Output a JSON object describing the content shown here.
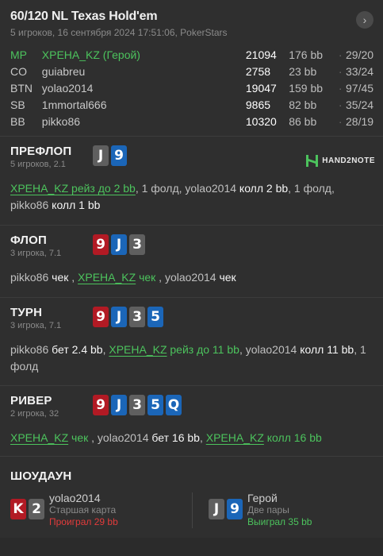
{
  "header": {
    "title": "60/120 NL Texas Hold'em",
    "subtitle": "5 игроков, 16 сентября 2024 17:51:06, PokerStars",
    "nav_icon": "chevron-right"
  },
  "players": [
    {
      "pos": "MP",
      "name": "ХРЕНА_KZ (Герой)",
      "stack": "21094",
      "bb": "176 bb",
      "stats": "29/20",
      "hero": true
    },
    {
      "pos": "CO",
      "name": "guiabreu",
      "stack": "2758",
      "bb": "23 bb",
      "stats": "33/24",
      "hero": false
    },
    {
      "pos": "BTN",
      "name": "yolao2014",
      "stack": "19047",
      "bb": "159 bb",
      "stats": "97/45",
      "hero": false
    },
    {
      "pos": "SB",
      "name": "1mmortal666",
      "stack": "9865",
      "bb": "82 bb",
      "stats": "35/24",
      "hero": false
    },
    {
      "pos": "BB",
      "name": "pikko86",
      "stack": "10320",
      "bb": "86 bb",
      "stats": "28/19",
      "hero": false
    }
  ],
  "separator": "·",
  "brand": {
    "logo_text": "HAND2NOTE",
    "color": "#4cc35d"
  },
  "preflop": {
    "name": "ПРЕФЛОП",
    "sub": "5 игроков, 2.1",
    "cards": [
      {
        "rank": "J",
        "color": "grey"
      },
      {
        "rank": "9",
        "color": "blue"
      }
    ],
    "a1": "ХРЕНА_KZ рейз до 2 bb",
    "a2": ", 1 фолд, yolao2014 ",
    "a3": "колл 2 bb",
    "a4": ", 1 фолд,",
    "a5": "pikko86 ",
    "a6": "колл 1 bb"
  },
  "flop": {
    "name": "ФЛОП",
    "sub": "3 игрока, 7.1",
    "cards": [
      {
        "rank": "9",
        "color": "red"
      },
      {
        "rank": "J",
        "color": "blue"
      },
      {
        "rank": "3",
        "color": "grey"
      }
    ],
    "a1": "pikko86 ",
    "a2": "чек",
    "a3": " , ",
    "a4": "ХРЕНА_KZ",
    "a5": " чек",
    "a6": " , yolao2014 ",
    "a7": "чек"
  },
  "turn": {
    "name": "ТУРН",
    "sub": "3 игрока, 7.1",
    "cards": [
      {
        "rank": "9",
        "color": "red"
      },
      {
        "rank": "J",
        "color": "blue"
      },
      {
        "rank": "3",
        "color": "grey"
      },
      {
        "rank": "5",
        "color": "blue"
      }
    ],
    "a1": "pikko86 ",
    "a2": "бет 2.4 bb",
    "a3": ", ",
    "a4": "ХРЕНА_KZ",
    "a5": " рейз до 11 bb",
    "a6": ", yolao2014 ",
    "a7": "колл 11 bb",
    "a8": ", 1",
    "a9": "фолд"
  },
  "river": {
    "name": "РИВЕР",
    "sub": "2 игрока, 32",
    "cards": [
      {
        "rank": "9",
        "color": "red"
      },
      {
        "rank": "J",
        "color": "blue"
      },
      {
        "rank": "3",
        "color": "grey"
      },
      {
        "rank": "5",
        "color": "blue"
      },
      {
        "rank": "Q",
        "color": "blue"
      }
    ],
    "a1": "ХРЕНА_KZ",
    "a2": " чек",
    "a3": " , yolao2014 ",
    "a4": "бет 16 bb",
    "a5": ", ",
    "a6": "ХРЕНА_KZ",
    "a7": " колл 16 bb"
  },
  "showdown": {
    "name": "ШОУДАУН",
    "left": {
      "cards": [
        {
          "rank": "K",
          "color": "red"
        },
        {
          "rank": "2",
          "color": "grey"
        }
      ],
      "player": "yolao2014",
      "hand": "Старшая карта",
      "result": "Проиграл 29 bb"
    },
    "right": {
      "cards": [
        {
          "rank": "J",
          "color": "grey"
        },
        {
          "rank": "9",
          "color": "blue"
        }
      ],
      "player": "Герой",
      "hand": "Две пары",
      "result": "Выиграл 35 bb"
    }
  }
}
